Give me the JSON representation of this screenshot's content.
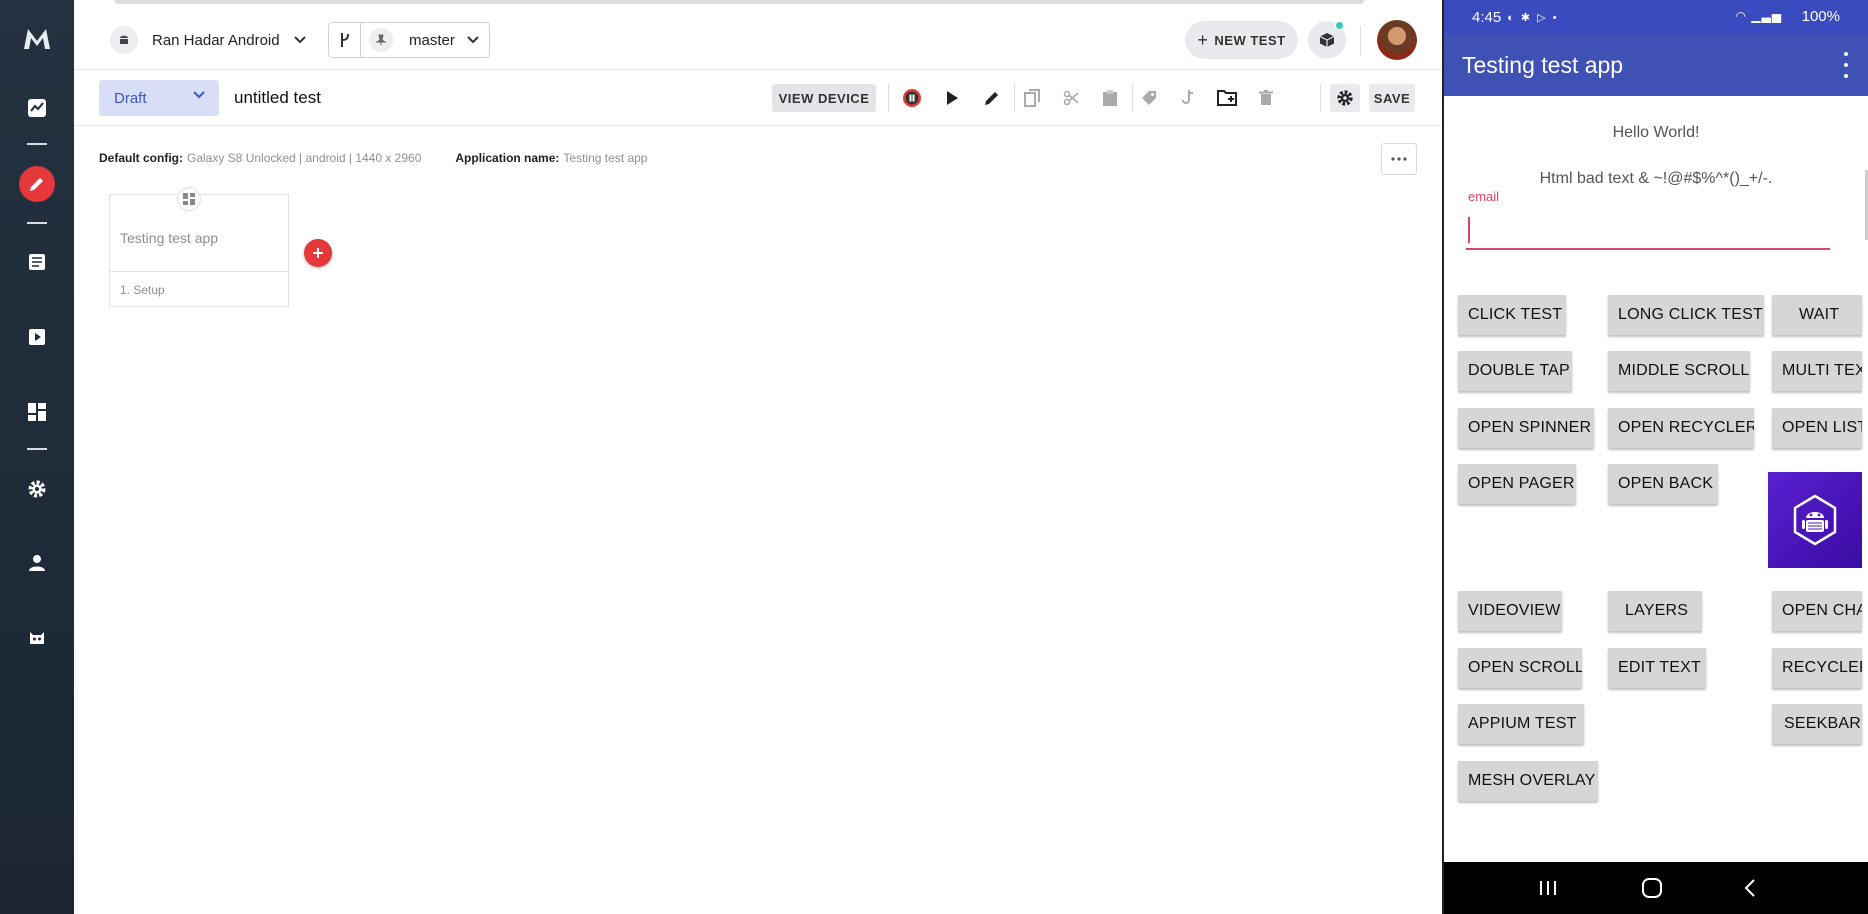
{
  "sidebar": {
    "logo": "mabl-logo",
    "items": [
      {
        "icon": "activity-icon"
      },
      {
        "icon": "edit-icon",
        "active": true
      },
      {
        "icon": "tests-icon"
      },
      {
        "icon": "runs-icon"
      },
      {
        "icon": "dashboard-icon"
      },
      {
        "icon": "settings-icon"
      },
      {
        "icon": "user-icon"
      },
      {
        "icon": "mabl-bot-icon"
      }
    ]
  },
  "header": {
    "project_name": "Ran Hadar Android",
    "branch": "master",
    "new_test_label": "NEW TEST"
  },
  "toolbar": {
    "status": "Draft",
    "test_name": "untitled test",
    "view_device_label": "VIEW DEVICE",
    "save_label": "SAVE"
  },
  "canvas": {
    "config_label": "Default config:",
    "config_value": "Galaxy S8 Unlocked | android | 1440 x 2960",
    "app_label": "Application name:",
    "app_value": "Testing test app",
    "card_title": "Testing test app",
    "card_step": "1. Setup"
  },
  "device": {
    "time": "4:45",
    "battery": "100%",
    "app_title": "Testing test app",
    "hello": "Hello World!",
    "bad_text": "Html bad text & ~!@#$%^*()_+/-.",
    "email_label": "email",
    "email_value": "",
    "buttons": {
      "click_test": "CLICK TEST",
      "long_click_test": "LONG CLICK TEST",
      "wait": "WAIT",
      "double_tap": "DOUBLE TAP",
      "middle_scroll": "MIDDLE SCROLL",
      "multi_text": "MULTI TEX",
      "open_spinner": "OPEN SPINNER",
      "open_recycler": "OPEN RECYCLER",
      "open_list": "OPEN LIST",
      "open_pager": "OPEN PAGER",
      "open_back": "OPEN BACK",
      "videoview": "VIDEOVIEW",
      "layers": "LAYERS",
      "open_cha": "OPEN CHA",
      "open_scroll": "OPEN SCROLL",
      "edit_text": "EDIT TEXT",
      "recycler": "RECYCLER",
      "appium_test": "APPIUM TEST",
      "seekbar": "SEEKBAR",
      "mesh_overlay": "MESH OVERLAY"
    }
  },
  "colors": {
    "sidebar_bg": "#1f2b38",
    "accent_red": "#e5383b",
    "android_primary": "#3f51b5",
    "email_accent": "#e0426b",
    "fab_purple": "#4b17b8"
  }
}
